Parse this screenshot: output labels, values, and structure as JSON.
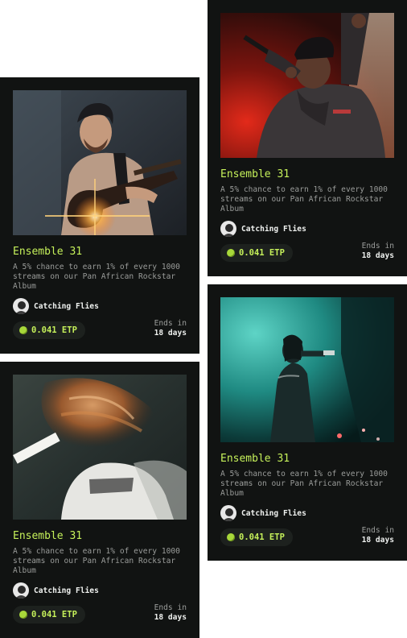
{
  "cards": [
    {
      "title": "Ensemble 31",
      "description": "A 5% chance to earn 1% of every 1000 streams on our Pan African Rockstar Album",
      "creator": "Catching Flies",
      "price": "0.041 ETP",
      "ends_label": "Ends in",
      "ends_value": "18 days",
      "image": "guitarist-photo"
    },
    {
      "title": "Ensemble 31",
      "description": "A 5% chance to earn 1% of every 1000 streams on our Pan African Rockstar Album",
      "creator": "Catching Flies",
      "price": "0.041 ETP",
      "ends_label": "Ends in",
      "ends_value": "18 days",
      "image": "rapper-with-mic-photo"
    },
    {
      "title": "Ensemble 31",
      "description": "A 5% chance to earn 1% of every 1000 streams on our Pan African Rockstar Album",
      "creator": "Catching Flies",
      "price": "0.041 ETP",
      "ends_label": "Ends in",
      "ends_value": "18 days",
      "image": "motion-blur-dancer-photo"
    },
    {
      "title": "Ensemble 31",
      "description": "A 5% chance to earn 1% of every 1000 streams on our Pan African Rockstar Album",
      "creator": "Catching Flies",
      "price": "0.041 ETP",
      "ends_label": "Ends in",
      "ends_value": "18 days",
      "image": "singer-teal-stage-photo"
    }
  ],
  "colors": {
    "card_background": "#111312",
    "accent": "#c5f05a",
    "muted_text": "#9a9c9a",
    "price_pill": "#1d211e"
  }
}
